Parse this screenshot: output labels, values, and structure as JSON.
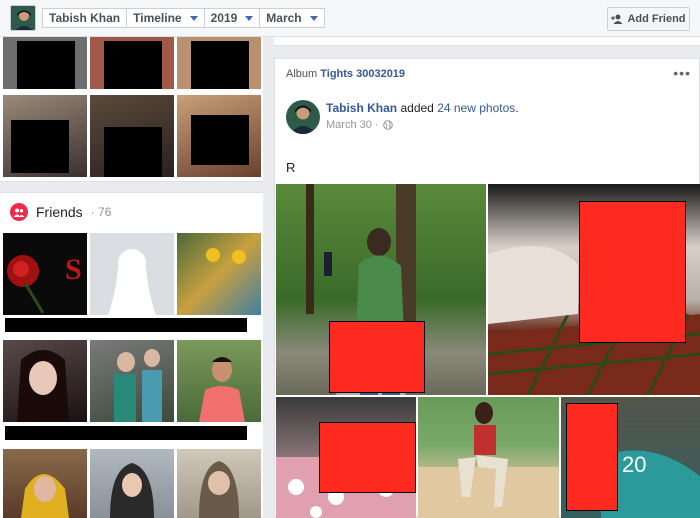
{
  "topbar": {
    "profile_name": "Tabish Khan",
    "section": "Timeline",
    "year": "2019",
    "month": "March",
    "add_friend_label": "Add Friend"
  },
  "friends": {
    "title": "Friends",
    "count_text": "· 76"
  },
  "post": {
    "album_prefix": "Album",
    "album_name": "Tights 30032019",
    "author": "Tabish Khan",
    "action_prefix": "added",
    "action_link": "24 new photos",
    "action_suffix": ".",
    "time": "March 30 ·",
    "text": "R",
    "more_photos_overlay": "20"
  },
  "colors": {
    "link_blue": "#365899",
    "friends_icon_red": "#f0284a",
    "censor_red": "#ff2a1f",
    "censor_black": "#000000"
  },
  "icons": [
    "user-avatar-icon",
    "caret-down-icon",
    "add-friend-icon",
    "friends-icon",
    "more-options-icon",
    "globe-icon"
  ]
}
